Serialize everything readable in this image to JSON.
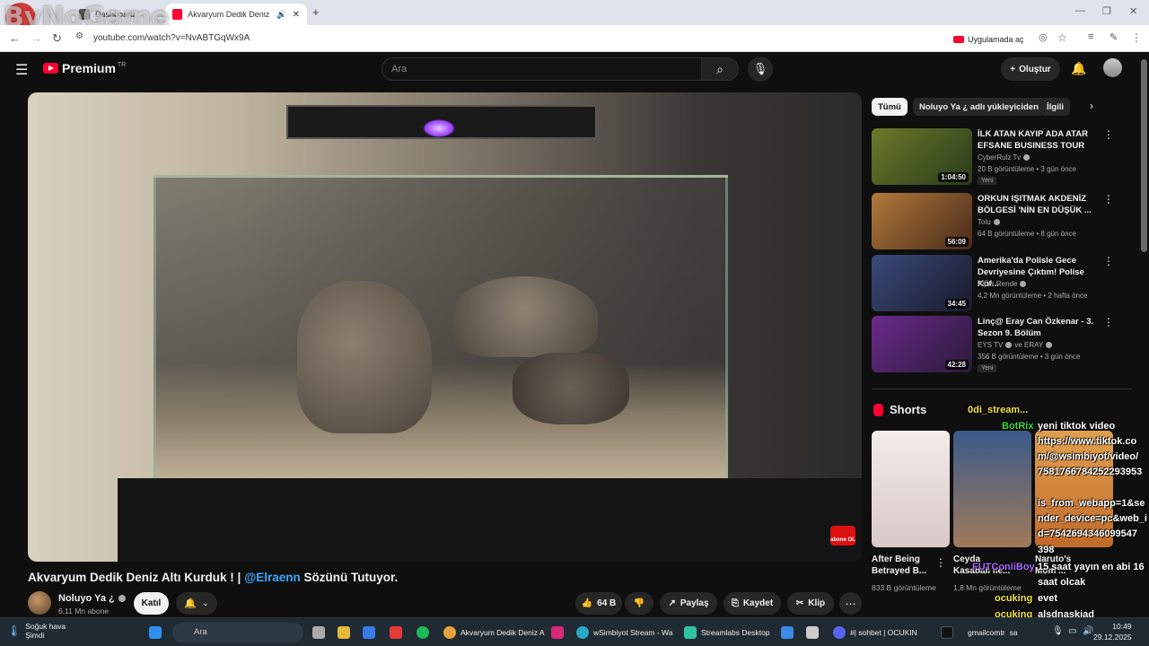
{
  "browser": {
    "tabs": [
      {
        "label": "Dashboard"
      },
      {
        "label": "Akvaryum Dedik Deniz Altı"
      }
    ],
    "url": "youtube.com/watch?v=NvABTGqWx9A",
    "open_in_app": "Uygulamada aç"
  },
  "overlay": {
    "logo_text": "ByNoGame"
  },
  "header": {
    "logo_text": "Premium",
    "logo_sup": "TR",
    "search_placeholder": "Ara",
    "create_label": "Oluştur"
  },
  "video": {
    "title_prefix": "Akvaryum Dedik Deniz Altı Kurduk ! |",
    "title_mention": "@Elraenn",
    "title_suffix": "Sözünü Tutuyor.",
    "watermark": "abone OL",
    "channel": {
      "name": "Noluyo Ya ¿",
      "subs": "6,11 Mn abone"
    },
    "join_label": "Katıl",
    "likes": "64 B",
    "share_label": "Paylaş",
    "save_label": "Kaydet",
    "clip_label": "Klip"
  },
  "sidebar": {
    "chips": [
      {
        "label": "Tümü"
      },
      {
        "label": "Noluyo Ya ¿ adlı yükleyiciden"
      },
      {
        "label": "İlgili"
      }
    ],
    "recommendations": [
      {
        "title": "İLK ATAN KAYIP ADA ATAR EFSANE BUSINESS TOUR",
        "channel": "CyberRulz Tv",
        "meta": "20 B görüntüleme • 3 gün önce",
        "badge": "Yeni",
        "duration": "1:04:50",
        "color": "#5a6a2a"
      },
      {
        "title": "ORKUN IŞITMAK AKDENİZ BÖLGESİ 'NİN EN DÜŞÜK ...",
        "channel": "Tolu",
        "meta": "64 B görüntüleme • 8 gün önce",
        "badge": "",
        "duration": "56:09",
        "color": "#8a5a2a"
      },
      {
        "title": "Amerika'da Polisle Gece Devriyesine Çıktım! Polise Küf...",
        "channel": "Alper Rende",
        "meta": "4,2 Mn görüntüleme • 2 hafta önce",
        "badge": "",
        "duration": "34:45",
        "color": "#2a3a5a"
      },
      {
        "title": "Linç@ Eray Can Özkenar - 3. Sezon 9. Bölüm",
        "channel": "EYS TV",
        "channel_extra": "ve ERAY",
        "meta": "356 B görüntüleme • 3 gün önce",
        "badge": "Yeni",
        "duration": "42:28",
        "color": "#4a2a6a"
      }
    ],
    "shorts_label": "Shorts",
    "shorts": [
      {
        "title": "After Being Betrayed B...",
        "views": "833 B görüntüleme"
      },
      {
        "title": "Ceyda Kasabalı ile...",
        "views": "1,8 Mn görüntüleme"
      },
      {
        "title": "Naruto's Mom ...",
        "views": "..."
      }
    ]
  },
  "chat": [
    {
      "text": "0di_stream...",
      "style": "yellow"
    },
    {
      "text": "BotRix",
      "style": "green"
    },
    {
      "text": "yeni tiktok video",
      "style": "white"
    },
    {
      "text": "https://www.tiktok.co",
      "style": "white"
    },
    {
      "text": "m/@wsimbiyot/video/",
      "style": "white"
    },
    {
      "text": "7581766784252293953",
      "style": "white"
    },
    {
      "text": "is_from_webapp=1&se",
      "style": "white"
    },
    {
      "text": "nder_device=pc&web_i",
      "style": "white"
    },
    {
      "text": "d=7542694346099547",
      "style": "white"
    },
    {
      "text": "398",
      "style": "white"
    },
    {
      "text": "FUTConiiBoy",
      "style": "purple"
    },
    {
      "text": "15 saat yayın en abi 16",
      "style": "white"
    },
    {
      "text": "saat olcak",
      "style": "white"
    },
    {
      "text": "ocuking",
      "style": "yellow"
    },
    {
      "text": "evet",
      "style": "white"
    },
    {
      "text": "ocuking",
      "style": "yellow"
    },
    {
      "text": "alsdnaskjad",
      "style": "white"
    }
  ],
  "taskbar": {
    "weather_label": "Soğuk hava",
    "weather_sub": "Şimdi",
    "search_label": "Ara",
    "apps": [
      {
        "label": "Akvaryum Dedik Deniz A"
      },
      {
        "label": "wSimbiyot Stream - Wa"
      },
      {
        "label": "Streamlabs Desktop"
      },
      {
        "label": "#| sohbet | OCUKIN"
      },
      {
        "label": "gmailcomtr"
      },
      {
        "label": "sa"
      }
    ],
    "time": "10:49",
    "date": "29.12.2025"
  }
}
